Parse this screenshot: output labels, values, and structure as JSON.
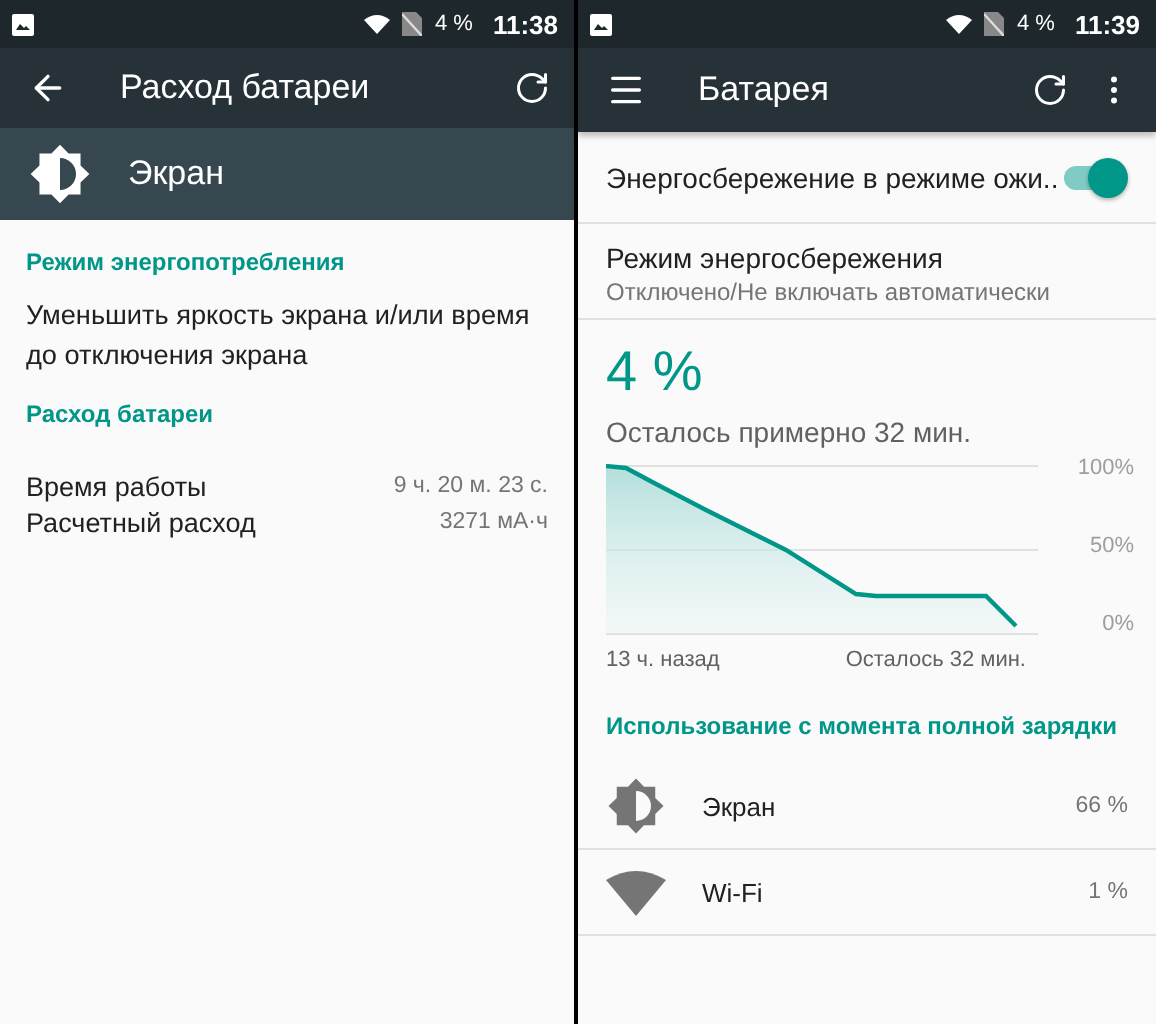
{
  "left_screen": {
    "status_bar": {
      "battery": "4 %",
      "time": "11:38"
    },
    "toolbar": {
      "title": "Расход батареи"
    },
    "app_header": {
      "title": "Экран"
    },
    "sections": [
      {
        "header": "Режим энергопотребления",
        "text": "Уменьшить яркость экрана и/или время до отключения экрана"
      },
      {
        "header": "Расход батареи",
        "rows": [
          {
            "label": "Время работы",
            "value": "9 ч. 20 м. 23 с."
          },
          {
            "label": "Расчетный расход",
            "value": "3271 мА·ч"
          }
        ]
      }
    ]
  },
  "right_screen": {
    "status_bar": {
      "battery": "4 %",
      "time": "11:39"
    },
    "toolbar": {
      "title": "Батарея"
    },
    "standby_saver": {
      "label": "Энергосбережение в режиме ожи..",
      "on": true
    },
    "saver_mode": {
      "title": "Режим энергосбережения",
      "summary": "Отключено/Не включать автоматически"
    },
    "battery": {
      "percent": "4 %",
      "estimate": "Осталось примерно 32 мин."
    },
    "graph": {
      "y_labels": [
        "100%",
        "50%",
        "0%"
      ],
      "start_label": "13 ч. назад",
      "end_label": "Осталось 32 мин."
    },
    "usage": {
      "header": "Использование с момента полной зарядки",
      "items": [
        {
          "kind": "screen",
          "name": "Экран",
          "percent": "66 %"
        },
        {
          "kind": "wifi",
          "name": "Wi-Fi",
          "percent": "1 %"
        }
      ]
    }
  }
}
